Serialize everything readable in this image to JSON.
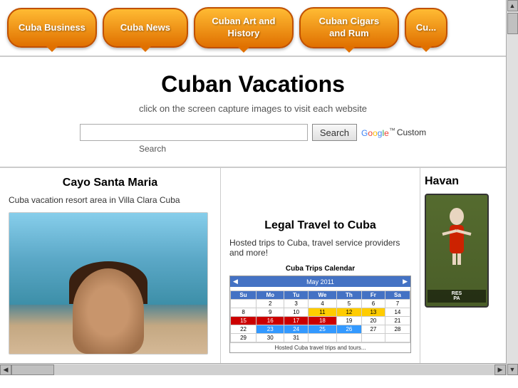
{
  "nav": {
    "buttons": [
      {
        "id": "cuba-business",
        "label": "Cuba Business"
      },
      {
        "id": "cuba-news",
        "label": "Cuba News"
      },
      {
        "id": "cuban-art",
        "label": "Cuban Art and History"
      },
      {
        "id": "cuban-cigars",
        "label": "Cuban Cigars and Rum"
      },
      {
        "id": "more",
        "label": "Cu..."
      }
    ]
  },
  "header": {
    "title": "Cuban Vacations",
    "subtitle": "click on the screen capture images to visit each website"
  },
  "search": {
    "input_value": "",
    "input_placeholder": "",
    "button_label": "Search",
    "label": "Search",
    "google_label": "Google",
    "custom_label": "Custom"
  },
  "cards": [
    {
      "id": "cayo-santa-maria",
      "title": "Cayo Santa Maria",
      "description": "Cuba vacation resort area in Villa Clara Cuba"
    },
    {
      "id": "legal-travel",
      "title": "Legal Travel to Cuba",
      "description": "Hosted trips to Cuba, travel service providers and more!",
      "calendar_title": "Cuba Trips Calendar"
    },
    {
      "id": "havana",
      "title": "Havan"
    }
  ]
}
